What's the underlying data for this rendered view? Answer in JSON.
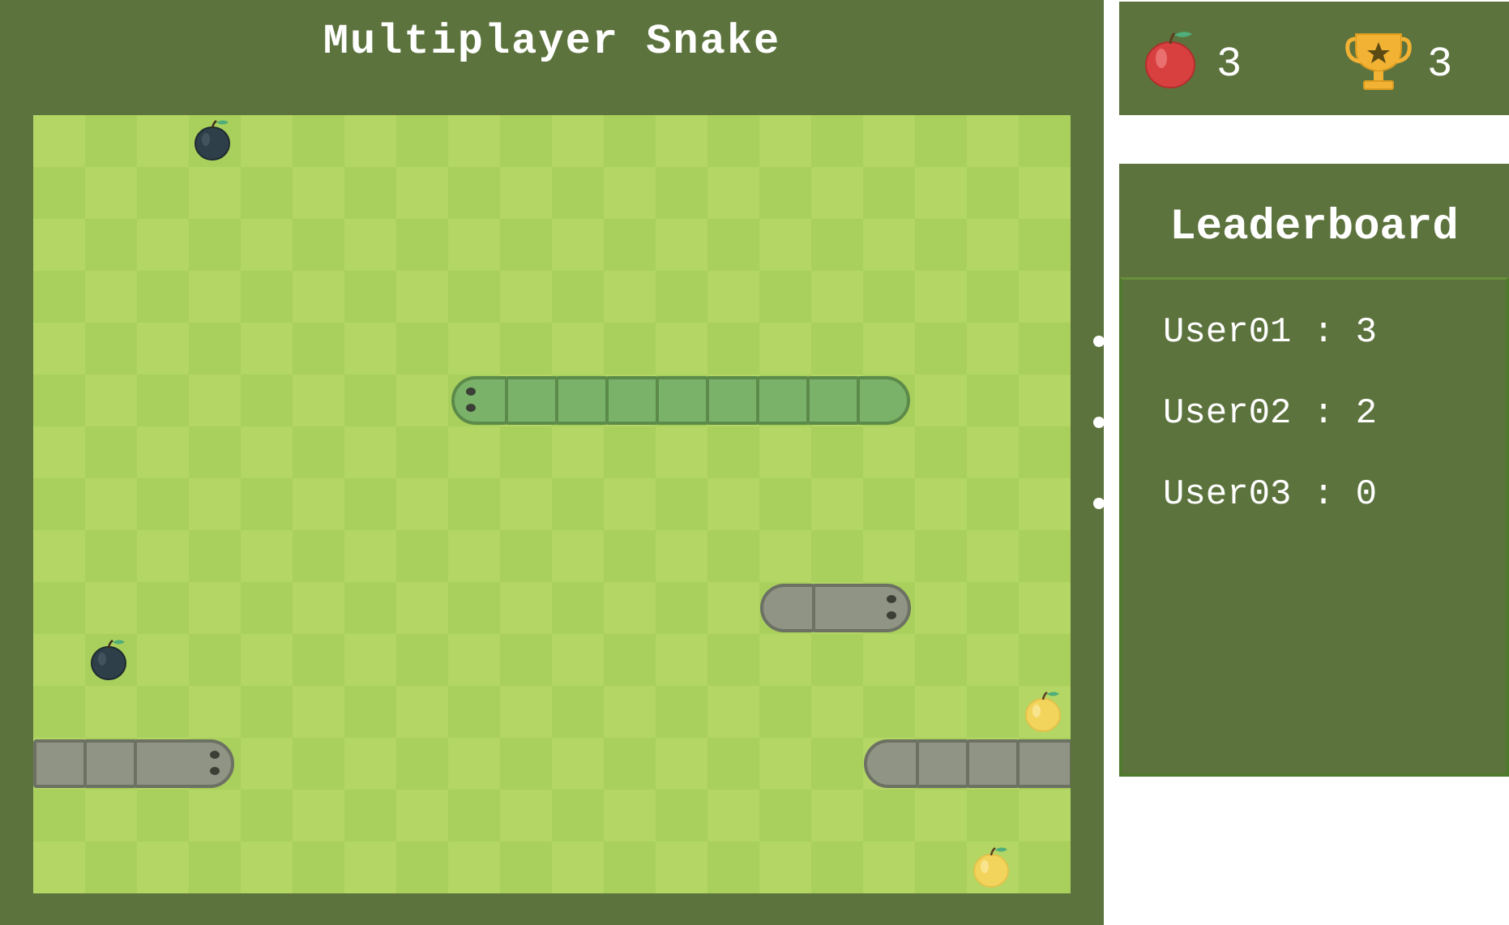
{
  "game": {
    "title": "Multiplayer Snake",
    "colors": {
      "panel": "#5c733d",
      "board_light": "#b3d665",
      "board_dark": "#a9cf5c",
      "player_snake": "#7bb26a",
      "opponent_snake": "#8f9484",
      "dark_apple": "#2f3f49",
      "yellow_apple": "#f2d45c"
    },
    "items": {
      "dark_apples": 2,
      "yellow_apples": 2,
      "snakes": 4
    }
  },
  "stats": {
    "apple_icon": "red-apple-icon",
    "apple_count": "3",
    "trophy_icon": "trophy-icon",
    "trophy_count": "3"
  },
  "leaderboard": {
    "title": "Leaderboard",
    "entries": [
      {
        "text": "User01 : 3"
      },
      {
        "text": "User02 : 2"
      },
      {
        "text": "User03 : 0"
      }
    ]
  }
}
